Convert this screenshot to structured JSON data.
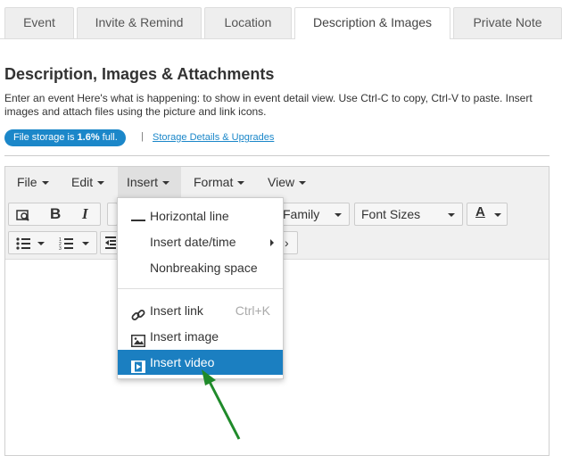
{
  "tabs": {
    "event": "Event",
    "invite": "Invite & Remind",
    "location": "Location",
    "description": "Description & Images",
    "private_note": "Private Note"
  },
  "page": {
    "title": "Description, Images & Attachments",
    "description": "Enter an event Here's what is happening: to show in event detail view. Use Ctrl-C to copy, Ctrl-V to paste. Insert images and attach files using the picture and link icons."
  },
  "storage": {
    "prefix": "File storage is ",
    "percent": "1.6%",
    "suffix": " full.",
    "separator": "|",
    "link": "Storage Details & Upgrades",
    "accent": "#1b87c9"
  },
  "editor": {
    "menu": {
      "file": "File",
      "edit": "Edit",
      "insert": "Insert",
      "format": "Format",
      "view": "View"
    },
    "toolbar": {
      "font_family": "Family",
      "font_sizes": "Font Sizes"
    }
  },
  "insert_menu": {
    "horizontal_line": "Horizontal line",
    "insert_date_time": "Insert date/time",
    "nonbreaking_space": "Nonbreaking space",
    "insert_link": "Insert link",
    "insert_link_shortcut": "Ctrl+K",
    "insert_image": "Insert image",
    "insert_video": "Insert video",
    "highlight_color": "#1b7fc1"
  },
  "annotation": {
    "arrow_color": "#1f8a2a",
    "icon": "pointer-arrow-icon"
  }
}
